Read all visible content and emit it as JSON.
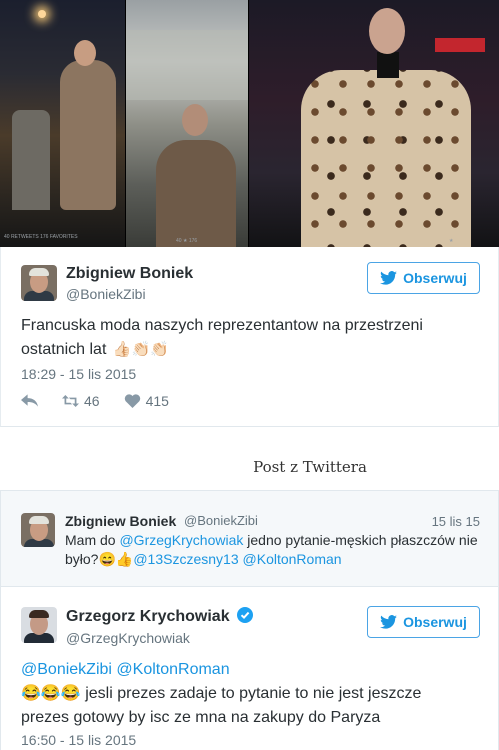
{
  "photos": {
    "meta_left": "40 RETWEETS 176 FAVORITES",
    "meta_mid": "40 ★ 176",
    "meta_right": "★"
  },
  "tweet": {
    "author_name": "Zbigniew Boniek",
    "author_handle": "@BoniekZibi",
    "follow_label": "Obserwuj",
    "text_line1": "Francuska moda naszych reprezentantow na przestrzeni",
    "text_line2": "ostatnich lat",
    "emoji": "👍🏻👏🏻👏🏻",
    "timestamp": "18:29 - 15 lis 2015",
    "retweets": "46",
    "likes": "415"
  },
  "caption": "Post z Twittera",
  "quoted_tweet": {
    "author_name": "Zbigniew Boniek",
    "author_handle": "@BoniekZibi",
    "date": "15 lis 15",
    "text_prefix": "Mam do ",
    "mention1": "@GrzegKrychowiak",
    "text_rest": " jedno pytanie-męskich płaszczów nie było?",
    "emoji": "😄👍",
    "mention2": "@13Szczesny13",
    "mention3": "@KoltonRoman"
  },
  "reply_tweet": {
    "author_name": "Grzegorz Krychowiak",
    "verified_icon": "verified-badge",
    "author_handle": "@GrzegKrychowiak",
    "follow_label": "Obserwuj",
    "mention1": "@BoniekZibi",
    "mention2": "@KoltonRoman",
    "emoji": "😂😂😂",
    "text": " jesli prezes zadaje to pytanie to nie jest jeszcze prezes gotowy by isc ze mna na zakupy do Paryza",
    "timestamp": "16:50 - 15 lis 2015"
  },
  "colors": {
    "twitter_blue": "#1b95e0",
    "text": "#292f33",
    "muted": "#66757f"
  }
}
